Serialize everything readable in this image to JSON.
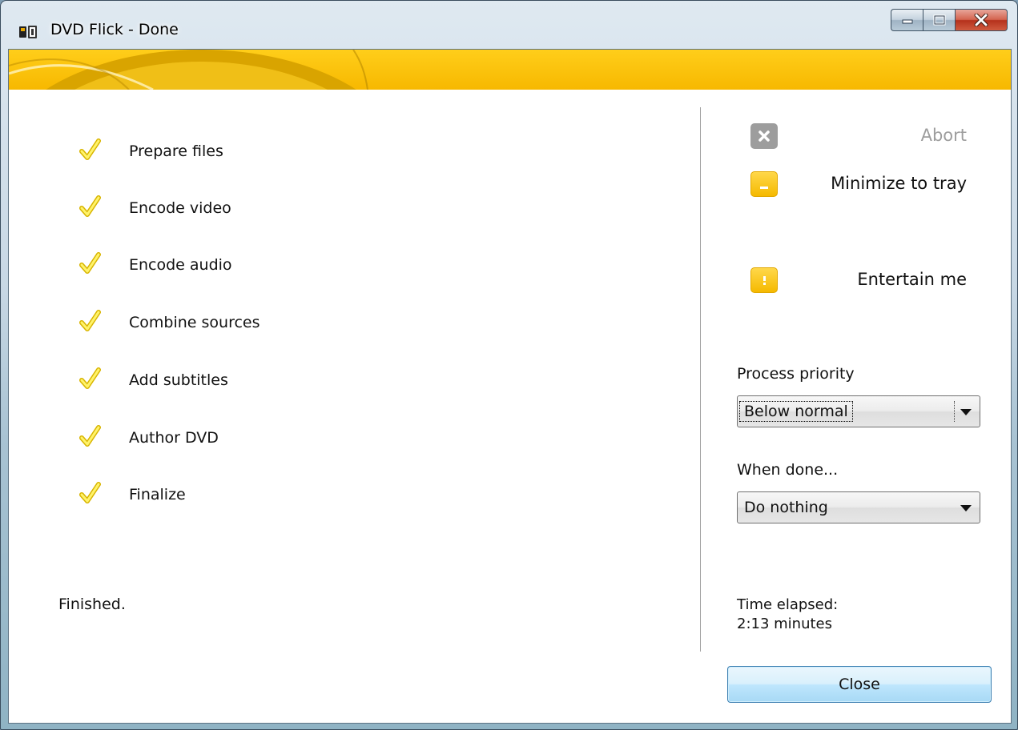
{
  "window": {
    "title": "DVD Flick - Done"
  },
  "steps": [
    {
      "label": "Prepare files",
      "status": "done"
    },
    {
      "label": "Encode video",
      "status": "done"
    },
    {
      "label": "Encode audio",
      "status": "done"
    },
    {
      "label": "Combine sources",
      "status": "done"
    },
    {
      "label": "Add subtitles",
      "status": "done"
    },
    {
      "label": "Author DVD",
      "status": "done"
    },
    {
      "label": "Finalize",
      "status": "done"
    }
  ],
  "status_text": "Finished.",
  "actions": {
    "abort": "Abort",
    "minimize": "Minimize to tray",
    "entertain": "Entertain me"
  },
  "priority": {
    "label": "Process priority",
    "value": "Below normal"
  },
  "when_done": {
    "label": "When done...",
    "value": "Do nothing"
  },
  "elapsed": {
    "label": "Time elapsed:",
    "value": "2:13 minutes"
  },
  "close_label": "Close",
  "colors": {
    "accent": "#f7b800",
    "check": "#f5d000",
    "disabled": "#9d9d9d"
  },
  "icons": {
    "app": "dvd-flick-icon",
    "step_done": "checkmark-icon",
    "abort": "x-icon",
    "minimize": "minimize-icon",
    "entertain": "exclamation-icon"
  }
}
